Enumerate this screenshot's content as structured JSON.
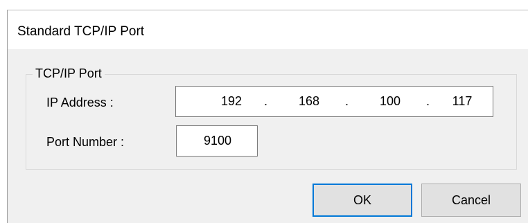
{
  "window": {
    "title": "Standard TCP/IP Port"
  },
  "group": {
    "title": "TCP/IP Port"
  },
  "fields": {
    "ip_label": "IP Address :",
    "ip_octets": [
      "192",
      "168",
      "100",
      "117"
    ],
    "port_label": "Port Number :",
    "port_value": "9100"
  },
  "buttons": {
    "ok_label": "OK",
    "cancel_label": "Cancel"
  },
  "colors": {
    "dialog_bg": "#f0f0f0",
    "default_button_border": "#0078d7",
    "button_bg": "#e1e1e1"
  }
}
